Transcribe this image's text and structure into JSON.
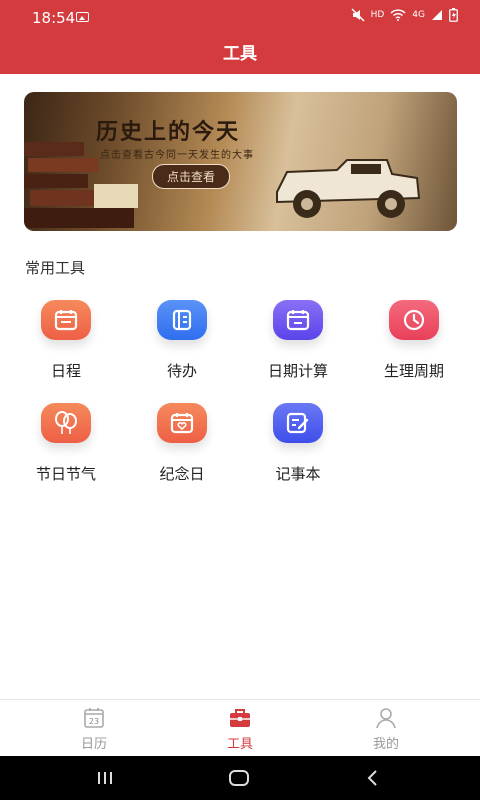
{
  "status": {
    "time": "18:54",
    "hd": "HD",
    "net": "4G"
  },
  "header": {
    "title": "工具"
  },
  "banner": {
    "title": "历史上的今天",
    "subtitle": "点击查看古今同一天发生的大事",
    "button": "点击查看"
  },
  "section": {
    "title": "常用工具"
  },
  "tools": [
    {
      "label": "日程",
      "icon": "calendar-icon",
      "color": "#f2714f"
    },
    {
      "label": "待办",
      "icon": "notebook-icon",
      "color": "#3f7ef2"
    },
    {
      "label": "日期计算",
      "icon": "calendar-calc-icon",
      "color": "#6b56f0"
    },
    {
      "label": "生理周期",
      "icon": "clock-icon",
      "color": "#ef4f66"
    },
    {
      "label": "节日节气",
      "icon": "balloon-icon",
      "color": "#f2714f"
    },
    {
      "label": "纪念日",
      "icon": "heart-calendar-icon",
      "color": "#f2714f"
    },
    {
      "label": "记事本",
      "icon": "note-edit-icon",
      "color": "#4f5ff2"
    }
  ],
  "nav": {
    "items": [
      {
        "label": "日历",
        "icon": "calendar-day-icon",
        "day": "23",
        "active": false
      },
      {
        "label": "工具",
        "icon": "toolbox-icon",
        "active": true
      },
      {
        "label": "我的",
        "icon": "user-icon",
        "active": false
      }
    ]
  }
}
